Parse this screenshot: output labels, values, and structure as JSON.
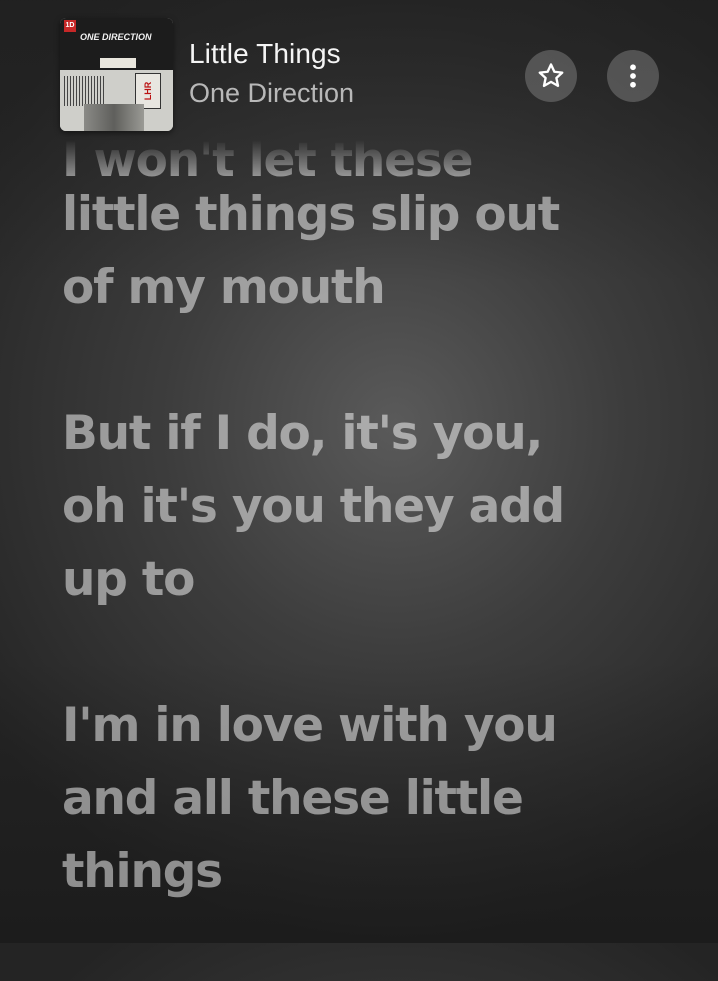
{
  "now_playing": {
    "title": "Little Things",
    "artist": "One Direction",
    "album_art": {
      "title_text": "ONE DIRECTION",
      "logo_text": "1D",
      "stamp_text": "LHR"
    }
  },
  "buttons": {
    "favorite_icon": "star-icon",
    "more_icon": "more-vertical-icon"
  },
  "lyrics": {
    "partial_line": "I won't let these",
    "blocks": [
      {
        "lines": [
          "little things slip out",
          "of my mouth"
        ]
      },
      {
        "lines": [
          "But if I do, it's you,",
          "oh it's you they add",
          "up to"
        ]
      },
      {
        "lines": [
          "I'm in love with you",
          "and all these little",
          "things"
        ]
      }
    ]
  },
  "colors": {
    "text_primary": "#f5f5f5",
    "text_secondary": "#b8b8b8",
    "background_center": "#5a5a5a",
    "background_edge": "#242424"
  }
}
